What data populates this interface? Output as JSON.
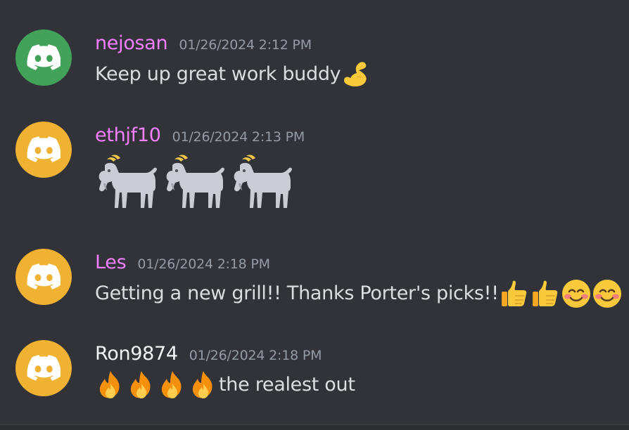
{
  "colors": {
    "background": "#313338",
    "timestamp": "#949ba4",
    "message_text": "#dbdee1",
    "avatar_green": "#43a25a",
    "avatar_orange": "#f0b232",
    "username_pink": "#f47fff",
    "username_white": "#f2f3f5"
  },
  "messages": [
    {
      "username": "nejosan",
      "timestamp": "01/26/2024 2:12 PM",
      "avatar_icon": "discord-logo-icon",
      "text": "Keep up great work buddy",
      "emojis": [
        "flexed-biceps-icon"
      ]
    },
    {
      "username": "ethjf10",
      "timestamp": "01/26/2024 2:13 PM",
      "avatar_icon": "discord-logo-icon",
      "text": "",
      "emojis": [
        "goat-icon",
        "goat-icon",
        "goat-icon"
      ]
    },
    {
      "username": "Les",
      "timestamp": "01/26/2024 2:18 PM",
      "avatar_icon": "discord-logo-icon",
      "text": "Getting a new grill!! Thanks Porter's picks!!",
      "emojis": [
        "thumbs-up-icon",
        "thumbs-up-icon",
        "smiling-face-icon",
        "smiling-face-icon"
      ]
    },
    {
      "username": "Ron9874",
      "timestamp": "01/26/2024 2:18 PM",
      "avatar_icon": "discord-logo-icon",
      "text": "the realest out",
      "emojis": [
        "fire-icon",
        "fire-icon",
        "fire-icon",
        "fire-icon"
      ]
    }
  ]
}
